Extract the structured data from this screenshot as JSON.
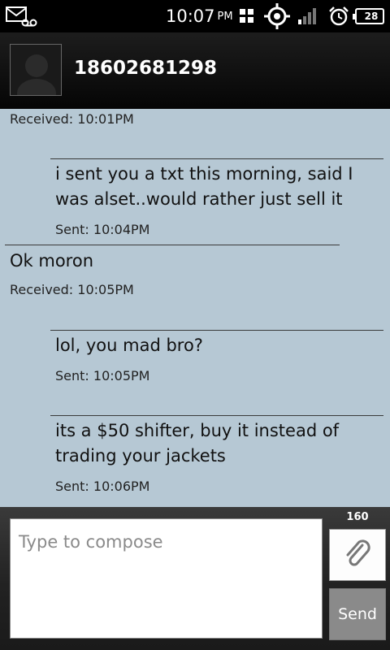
{
  "status_bar": {
    "time": "10:07",
    "ampm": "PM",
    "battery_level": "28",
    "icons": [
      "sms-voicemail-icon",
      "grid-icon",
      "gps-icon",
      "signal-icon",
      "alarm-icon",
      "battery-icon"
    ]
  },
  "header": {
    "contact_name": "18602681298",
    "avatar_icon": "default-avatar-icon"
  },
  "thread": {
    "messages": [
      {
        "direction": "received",
        "text": "",
        "timestamp": "Received: 10:01PM"
      },
      {
        "direction": "sent",
        "line1": "i sent you a txt this morning, said I",
        "line2": "was alset..would rather just sell it",
        "timestamp": "Sent: 10:04PM"
      },
      {
        "direction": "received",
        "line1": "Ok moron",
        "timestamp": "Received: 10:05PM"
      },
      {
        "direction": "sent",
        "line1": "lol, you mad bro?",
        "timestamp": "Sent: 10:05PM"
      },
      {
        "direction": "sent",
        "line1": "its a $50 shifter, buy it instead of",
        "line2": "trading your jackets",
        "timestamp": "Sent: 10:06PM"
      }
    ]
  },
  "compose": {
    "placeholder": "Type to compose",
    "value": "",
    "char_count": "160",
    "send_label": "Send",
    "attach_icon": "paperclip-icon"
  },
  "colors": {
    "thread_background": "#b6c8d4",
    "send_button": "#8a8a8a"
  }
}
